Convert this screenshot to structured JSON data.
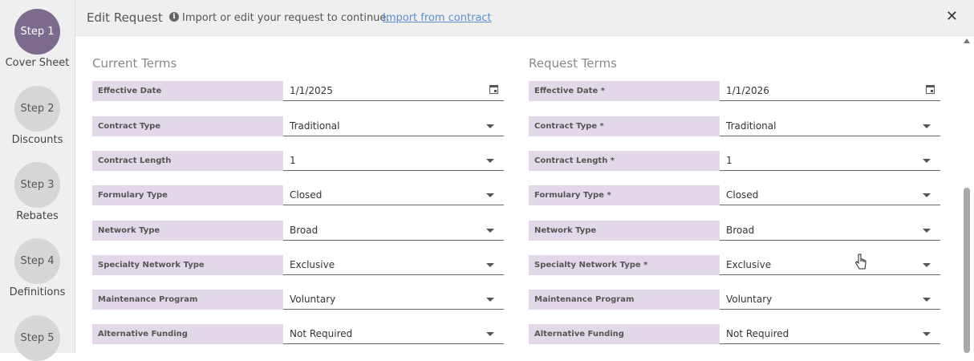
{
  "sidebar": {
    "steps": [
      {
        "number": "Step 1",
        "label": "Cover Sheet"
      },
      {
        "number": "Step 2",
        "label": "Discounts"
      },
      {
        "number": "Step 3",
        "label": "Rebates"
      },
      {
        "number": "Step 4",
        "label": "Definitions"
      },
      {
        "number": "Step 5",
        "label": ""
      }
    ]
  },
  "header": {
    "title": "Edit Request",
    "info_text": "Import or edit your request to continue.",
    "import_link": "Import from contract",
    "close": "✕"
  },
  "current": {
    "title": "Current Terms",
    "rows": [
      {
        "label": "Effective Date",
        "value": "1/1/2025"
      },
      {
        "label": "Contract Type",
        "value": "Traditional"
      },
      {
        "label": "Contract Length",
        "value": "1"
      },
      {
        "label": "Formulary Type",
        "value": "Closed"
      },
      {
        "label": "Network Type",
        "value": "Broad"
      },
      {
        "label": "Specialty Network Type",
        "value": "Exclusive"
      },
      {
        "label": "Maintenance Program",
        "value": "Voluntary"
      },
      {
        "label": "Alternative Funding",
        "value": "Not Required"
      }
    ]
  },
  "request": {
    "title": "Request Terms",
    "rows": [
      {
        "label": "Effective Date *",
        "value": "1/1/2026"
      },
      {
        "label": "Contract Type *",
        "value": "Traditional"
      },
      {
        "label": "Contract Length *",
        "value": "1"
      },
      {
        "label": "Formulary Type *",
        "value": "Closed"
      },
      {
        "label": "Network Type",
        "value": "Broad"
      },
      {
        "label": "Specialty Network Type *",
        "value": "Exclusive"
      },
      {
        "label": "Maintenance Program",
        "value": "Voluntary"
      },
      {
        "label": "Alternative Funding",
        "value": "Not Required"
      }
    ]
  }
}
